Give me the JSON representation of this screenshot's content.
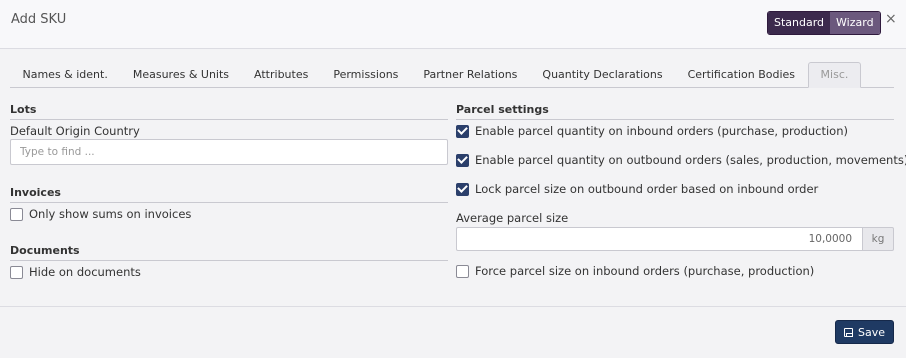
{
  "dialog": {
    "title": "Add SKU"
  },
  "mode": {
    "standard_label": "Standard",
    "wizard_label": "Wizard"
  },
  "close": {
    "symbol": "×"
  },
  "tabs": [
    {
      "label": "Names & ident."
    },
    {
      "label": "Measures & Units"
    },
    {
      "label": "Attributes"
    },
    {
      "label": "Permissions"
    },
    {
      "label": "Partner Relations"
    },
    {
      "label": "Quantity Declarations"
    },
    {
      "label": "Certification Bodies"
    },
    {
      "label": "Misc."
    }
  ],
  "active_tab": "Misc.",
  "lots": {
    "section_title": "Lots",
    "origin_label": "Default Origin Country",
    "origin_placeholder": "Type to find ..."
  },
  "invoices": {
    "section_title": "Invoices",
    "only_sums_label": "Only show sums on invoices",
    "only_sums_checked": false
  },
  "documents": {
    "section_title": "Documents",
    "hide_label": "Hide on documents",
    "hide_checked": false
  },
  "parcel": {
    "section_title": "Parcel settings",
    "inbound_label": "Enable parcel quantity on inbound orders (purchase, production)",
    "inbound_checked": true,
    "outbound_label": "Enable parcel quantity on outbound orders (sales, production, movements)",
    "outbound_checked": true,
    "lock_label": "Lock parcel size on outbound order based on inbound order",
    "lock_checked": true,
    "avg_label": "Average parcel size",
    "avg_value": "10,0000",
    "avg_unit": "kg",
    "force_label": "Force parcel size on inbound orders (purchase, production)",
    "force_checked": false
  },
  "footer": {
    "save_label": "Save"
  },
  "colors": {
    "primary": "#1f3a63",
    "mode_dark": "#3c2a4d",
    "mode_accent": "#6b587d"
  }
}
